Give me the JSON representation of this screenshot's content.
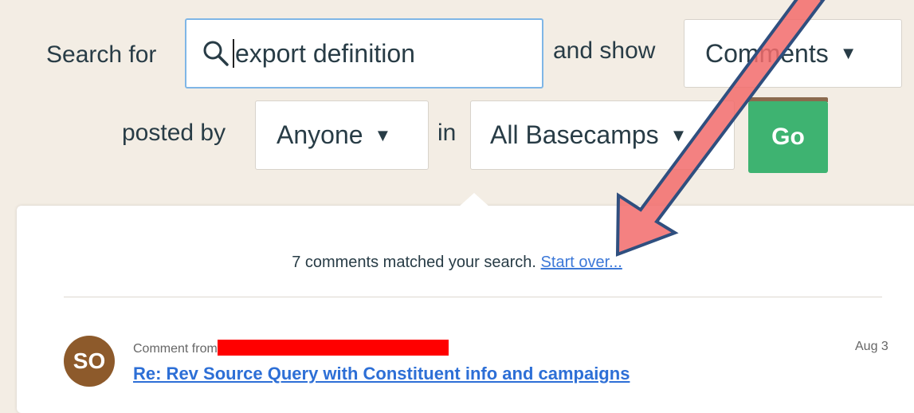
{
  "search_form": {
    "search_for_label": "Search for",
    "query_value": "export definition",
    "and_show_label": "and show",
    "type_selected": "Comments",
    "posted_by_label": "posted by",
    "author_selected": "Anyone",
    "in_label": "in",
    "scope_selected": "All Basecamps",
    "go_label": "Go"
  },
  "results": {
    "summary_text": "7 comments matched your search.",
    "start_over_label": "Start over...",
    "items": [
      {
        "avatar_initials": "SO",
        "avatar_color": "#8d5a2b",
        "meta_prefix": "Comment from",
        "date": "Aug 3",
        "title": "Re: Rev Source Query with Constituent info and campaigns"
      }
    ]
  },
  "colors": {
    "background": "#f3ede4",
    "go_button": "#3eb371",
    "link": "#2d6fd6",
    "annotation_arrow": "#f26b6b",
    "redaction": "#ff0000"
  },
  "icons": {
    "search": "search-icon",
    "dropdown": "dropdown-triangle-icon"
  }
}
